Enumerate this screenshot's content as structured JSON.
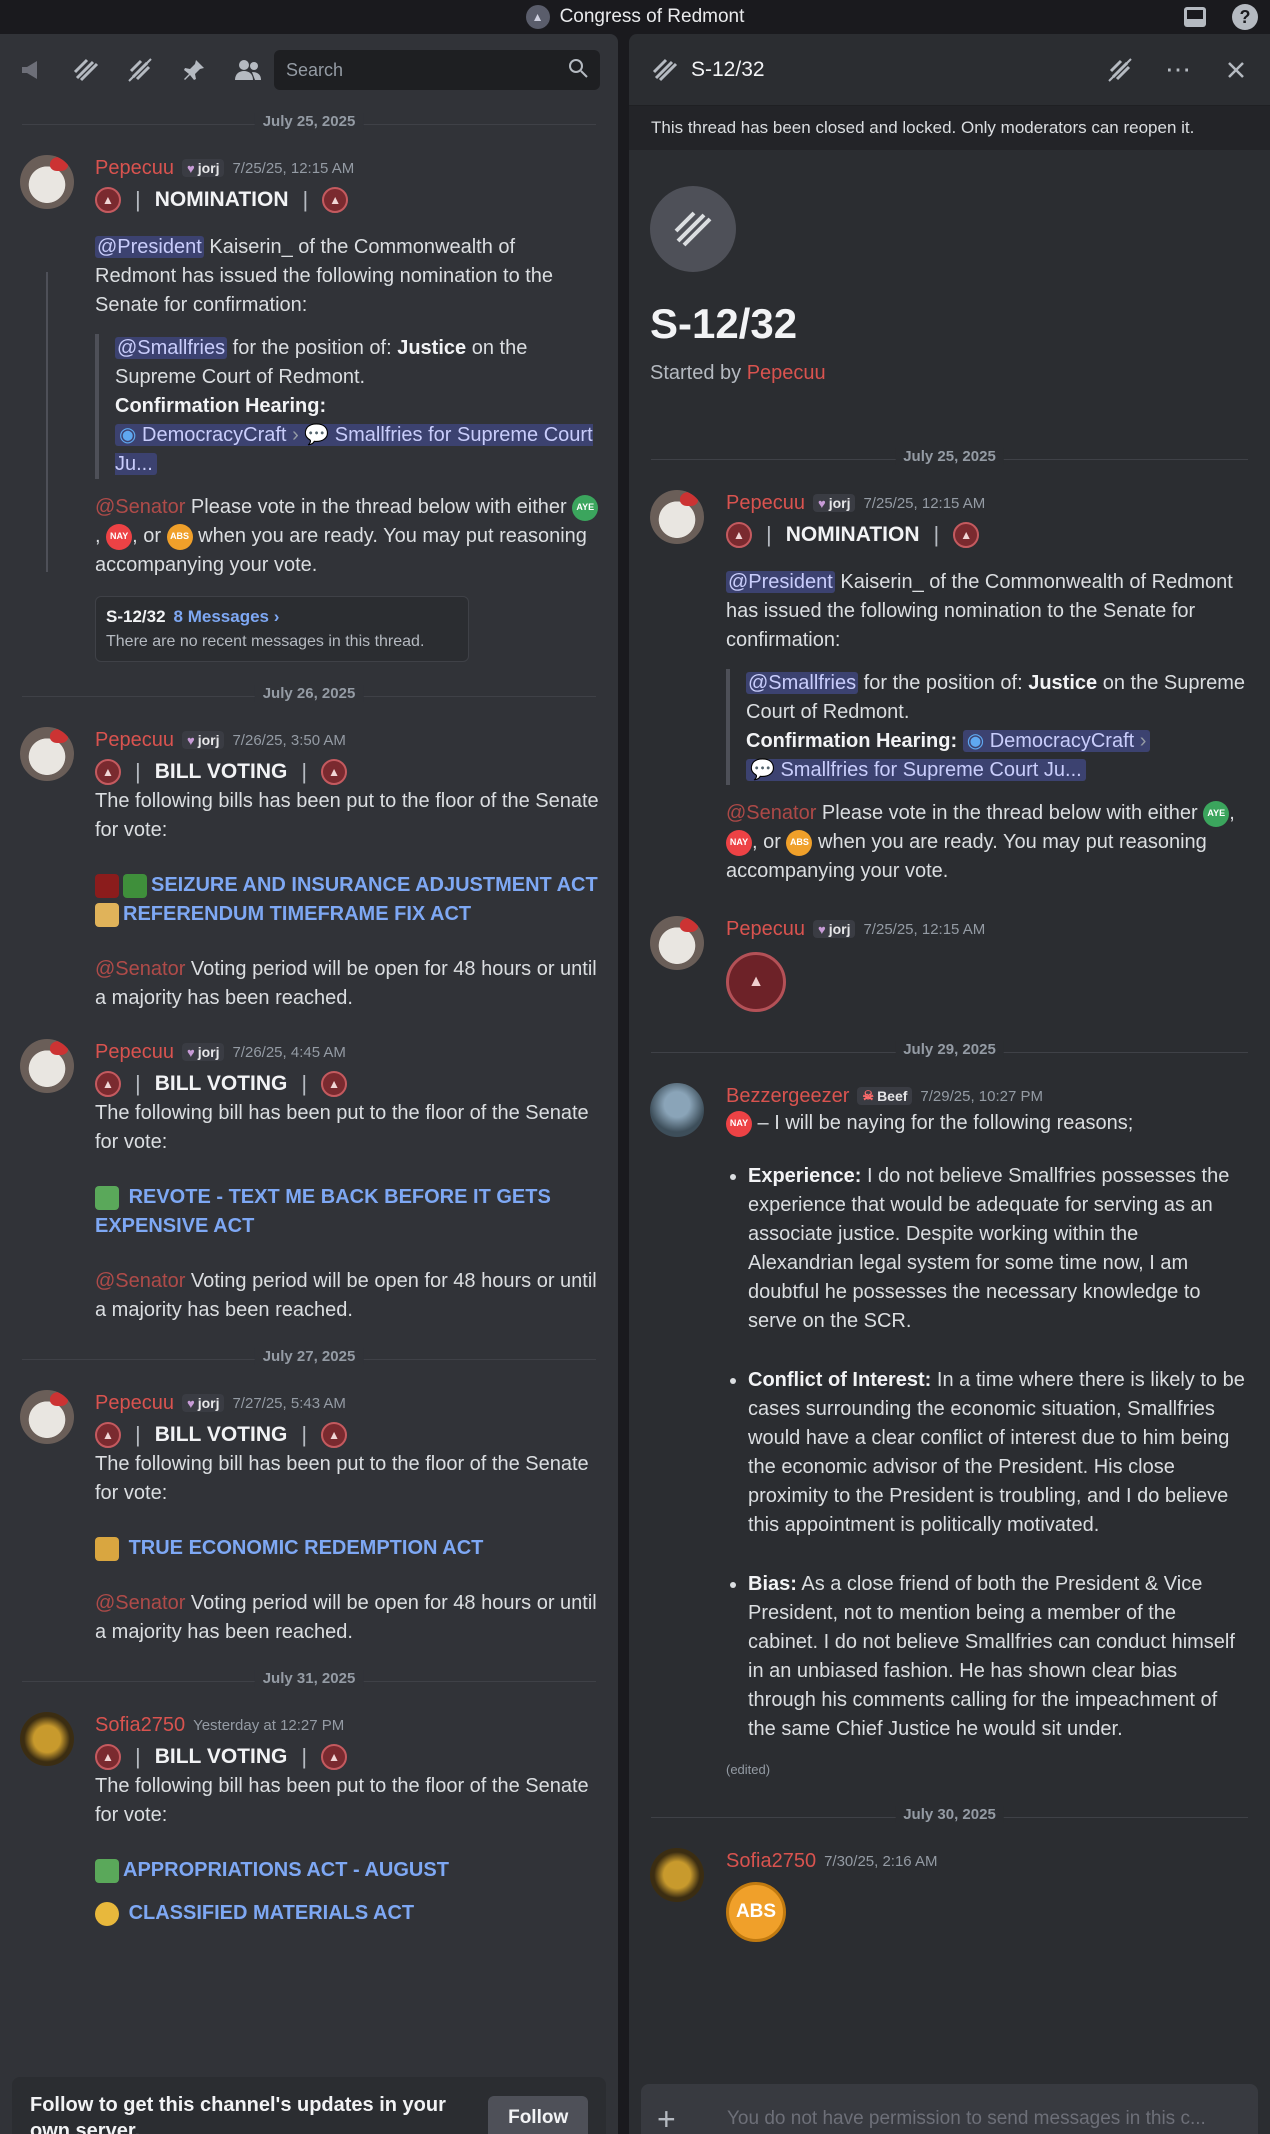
{
  "window": {
    "title": "Congress of Redmont"
  },
  "left": {
    "search_placeholder": "Search",
    "dates": [
      "July 25, 2025",
      "July 26, 2025",
      "July 27, 2025",
      "July 31, 2025"
    ],
    "m1": {
      "user": "Pepecuu",
      "tag": "jorj",
      "time": "7/25/25, 12:15 AM",
      "banner": "NOMINATION",
      "p1_mention": "@President",
      "p1_text": " Kaiserin_ of the Commonwealth of Redmont has issued the following nomination to the Senate for confirmation:",
      "q_mention": "@Smallfries",
      "q_text1": " for the position of: ",
      "q_bold": "Justice",
      "q_text2": " on the Supreme Court of Redmont.",
      "q_hearing": "Confirmation Hearing:",
      "q_chip1": "DemocracyCraft",
      "q_chip2": "Smallfries for Supreme Court Ju...",
      "p2_mention": "@Senator",
      "p2_text1": " Please vote in the thread below with either ",
      "p2_text2": ", ",
      "p2_text3": ", or ",
      "p2_text4": " when you are ready. You may put reasoning accompanying your vote.",
      "aye": "AYE",
      "nay": "NAY",
      "abs": "ABS",
      "thread_name": "S-12/32",
      "thread_count": "8 Messages ›",
      "thread_sub": "There are no recent messages in this thread."
    },
    "m2": {
      "user": "Pepecuu",
      "tag": "jorj",
      "time": "7/26/25, 3:50 AM",
      "banner": "BILL VOTING",
      "intro": "The following bills has been put to the floor of the Senate for vote:",
      "link1": "SEIZURE AND INSURANCE ADJUSTMENT ACT",
      "link2": "REFERENDUM TIMEFRAME FIX ACT",
      "mention": "@Senator",
      "outro": " Voting period will be open for 48 hours or until a majority has been reached."
    },
    "m3": {
      "user": "Pepecuu",
      "tag": "jorj",
      "time": "7/26/25, 4:45 AM",
      "banner": "BILL VOTING",
      "intro": "The following bill has been put to the floor of the Senate for vote:",
      "link1": "REVOTE - TEXT ME BACK BEFORE IT GETS EXPENSIVE ACT",
      "mention": "@Senator",
      "outro": " Voting period will be open for 48 hours or until a majority has been reached."
    },
    "m4": {
      "user": "Pepecuu",
      "tag": "jorj",
      "time": "7/27/25, 5:43 AM",
      "banner": "BILL VOTING",
      "intro": "The following bill has been put to the floor of the Senate for vote:",
      "link1": "TRUE ECONOMIC REDEMPTION ACT",
      "mention": "@Senator",
      "outro": " Voting period will be open for 48 hours or until a majority has been reached."
    },
    "m5": {
      "user": "Sofia2750",
      "time": "Yesterday at 12:27 PM",
      "banner": "BILL VOTING",
      "intro": "The following bill has been put to the floor of the Senate for vote:",
      "link1": "APPROPRIATIONS ACT - AUGUST",
      "link2": "CLASSIFIED MATERIALS ACT"
    },
    "follow_text": "Follow to get this channel's updates in your own server.",
    "follow_button": "Follow"
  },
  "right": {
    "header_title": "S-12/32",
    "closed_banner": "This thread has been closed and locked. Only moderators can reopen it.",
    "hero_title": "S-12/32",
    "started_by_label": "Started by ",
    "started_by_user": "Pepecuu",
    "dates": [
      "July 25, 2025",
      "July 29, 2025",
      "July 30, 2025"
    ],
    "m1": {
      "user": "Pepecuu",
      "tag": "jorj",
      "time": "7/25/25, 12:15 AM",
      "banner": "NOMINATION",
      "p1_mention": "@President",
      "p1_text": " Kaiserin_ of the Commonwealth of Redmont has issued the following nomination to the Senate for confirmation:",
      "q_mention": "@Smallfries",
      "q_text1": " for the position of: ",
      "q_bold": "Justice",
      "q_text2": " on the Supreme Court of Redmont.",
      "q_hearing": "Confirmation Hearing:",
      "q_chip1": "DemocracyCraft",
      "q_chip2": "Smallfries for Supreme Court Ju...",
      "p2_mention": "@Senator",
      "p2_text1": " Please vote in the thread below with either ",
      "p2_text2": ", ",
      "p2_text3": ", or ",
      "p2_text4": " when you are ready. You may put reasoning accompanying your vote.",
      "aye": "AYE",
      "nay": "NAY",
      "abs": "ABS"
    },
    "m2": {
      "user": "Pepecuu",
      "tag": "jorj",
      "time": "7/25/25, 12:15 AM"
    },
    "m3": {
      "user": "Bezzergeezer",
      "tag": "Beef",
      "time": "7/29/25, 10:27 PM",
      "nay": "NAY",
      "intro": " – I will be naying for the following reasons;",
      "b1_title": "Experience:",
      "b1_text": " I do not believe Smallfries possesses the experience that would be adequate for serving as an associate justice. Despite working within the Alexandrian legal system for some time now, I am doubtful he possesses the necessary knowledge to serve on the SCR.",
      "b2_title": "Conflict of Interest:",
      "b2_text": " In a time where there is likely to be cases surrounding the economic situation, Smallfries would have a clear conflict of interest due to him being the economic advisor of the President. His close proximity to the President is troubling, and I do believe this appointment is politically motivated.",
      "b3_title": "Bias:",
      "b3_text": " As a close friend of both the President & Vice President, not to mention being a member of the cabinet. I do not believe Smallfries can conduct himself in an unbiased fashion. He has shown clear bias through his comments calling for the impeachment of the same Chief Justice he would sit under.",
      "edited": "(edited)"
    },
    "m4": {
      "user": "Sofia2750",
      "time": "7/30/25, 2:16 AM",
      "abs": "ABS"
    },
    "composer_placeholder": "You do not have permission to send messages in this c..."
  }
}
